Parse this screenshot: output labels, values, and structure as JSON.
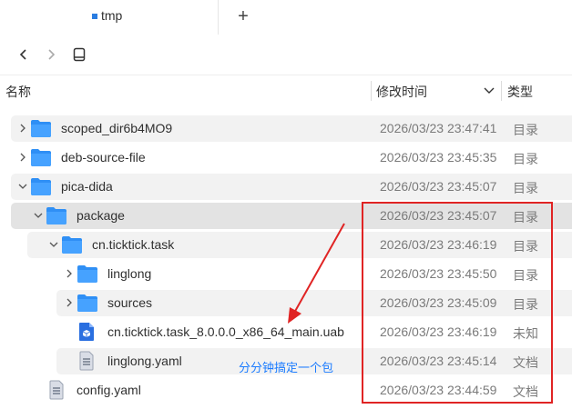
{
  "tab": {
    "label": "tmp"
  },
  "header": {
    "name": "名称",
    "time": "修改时间",
    "type": "类型"
  },
  "rows": [
    {
      "name": "scoped_dir6b4MO9",
      "time": "2026/03/23 23:47:41",
      "type": "目录"
    },
    {
      "name": "deb-source-file",
      "time": "2026/03/23 23:45:35",
      "type": "目录"
    },
    {
      "name": "pica-dida",
      "time": "2026/03/23 23:45:07",
      "type": "目录"
    },
    {
      "name": "package",
      "time": "2026/03/23 23:45:07",
      "type": "目录"
    },
    {
      "name": "cn.ticktick.task",
      "time": "2026/03/23 23:46:19",
      "type": "目录"
    },
    {
      "name": "linglong",
      "time": "2026/03/23 23:45:50",
      "type": "目录"
    },
    {
      "name": "sources",
      "time": "2026/03/23 23:45:09",
      "type": "目录"
    },
    {
      "name": "cn.ticktick.task_8.0.0.0_x86_64_main.uab",
      "time": "2026/03/23 23:46:19",
      "type": "未知"
    },
    {
      "name": "linglong.yaml",
      "time": "2026/03/23 23:45:14",
      "type": "文档"
    },
    {
      "name": "config.yaml",
      "time": "2026/03/23 23:44:59",
      "type": "文档"
    }
  ],
  "annotation": {
    "note": "分分钟搞定一个包",
    "color": "#e02424"
  },
  "colors": {
    "folder": "#2f8ff5",
    "accent": "#2a7de1"
  }
}
